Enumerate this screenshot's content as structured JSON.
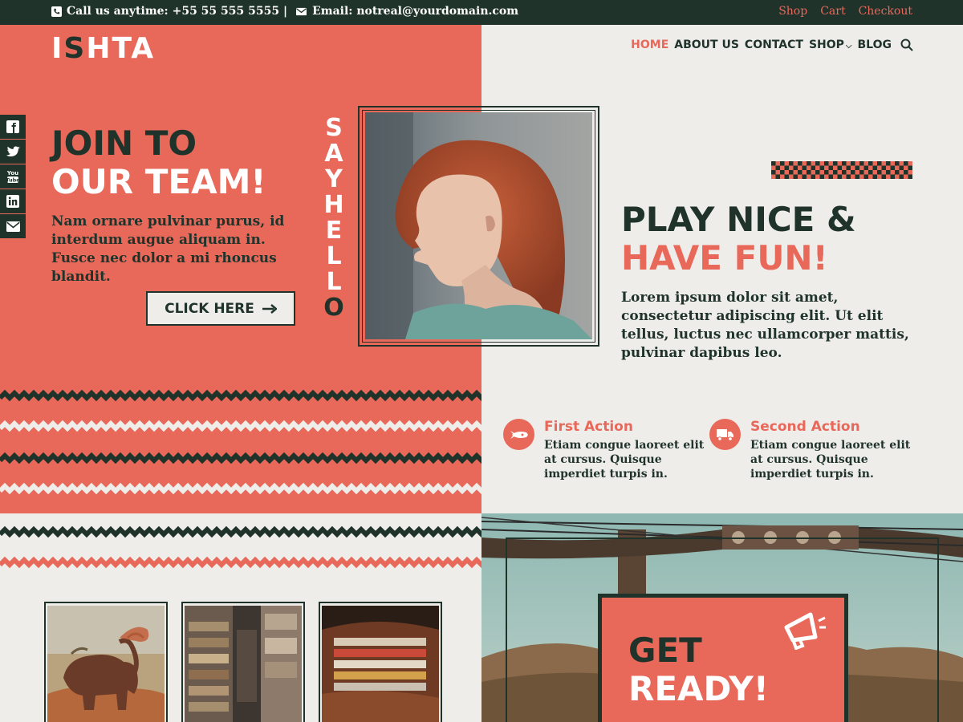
{
  "topbar": {
    "phone": "Call us anytime: +55 55 555 5555 |",
    "email": "Email: notreal@yourdomain.com",
    "links": [
      "Shop",
      "Cart",
      "Checkout"
    ]
  },
  "logo": {
    "part1": "I",
    "part2": "S",
    "part3": "HTA"
  },
  "nav": {
    "items": [
      "HOME",
      "ABOUT US",
      "CONTACT",
      "SHOP",
      "BLOG"
    ],
    "active": "HOME"
  },
  "social": {
    "items": [
      "facebook",
      "twitter",
      "youtube",
      "linkedin",
      "email"
    ],
    "youtube_text": "You\nTube"
  },
  "hero_left": {
    "title_line1": "JOIN TO",
    "title_line2": "OUR TEAM!",
    "text": "Nam ornare pulvinar purus, id interdum augue aliquam in. Fusce nec dolor a mi rhoncus blandit.",
    "button": "CLICK HERE"
  },
  "say_hello": {
    "text": "SAY HELLO"
  },
  "hero_right": {
    "title_line1": "PLAY NICE &",
    "title_line2": "HAVE FUN!",
    "text": "Lorem ipsum dolor sit amet, consectetur adipiscing elit. Ut elit tellus, luctus nec ullamcorper mattis, pulvinar dapibus leo."
  },
  "actions": [
    {
      "title": "First Action",
      "desc": "Etiam congue laoreet elit at cursus. Quisque imperdiet turpis in.",
      "icon": "rocket-icon"
    },
    {
      "title": "Second Action",
      "desc": "Etiam congue laoreet elit at cursus. Quisque imperdiet turpis in.",
      "icon": "truck-icon"
    }
  ],
  "get_ready": {
    "line1": "GET",
    "line2": "READY!"
  },
  "colors": {
    "salmon": "#e8685a",
    "dark": "#1f332b",
    "cream": "#efedea"
  }
}
